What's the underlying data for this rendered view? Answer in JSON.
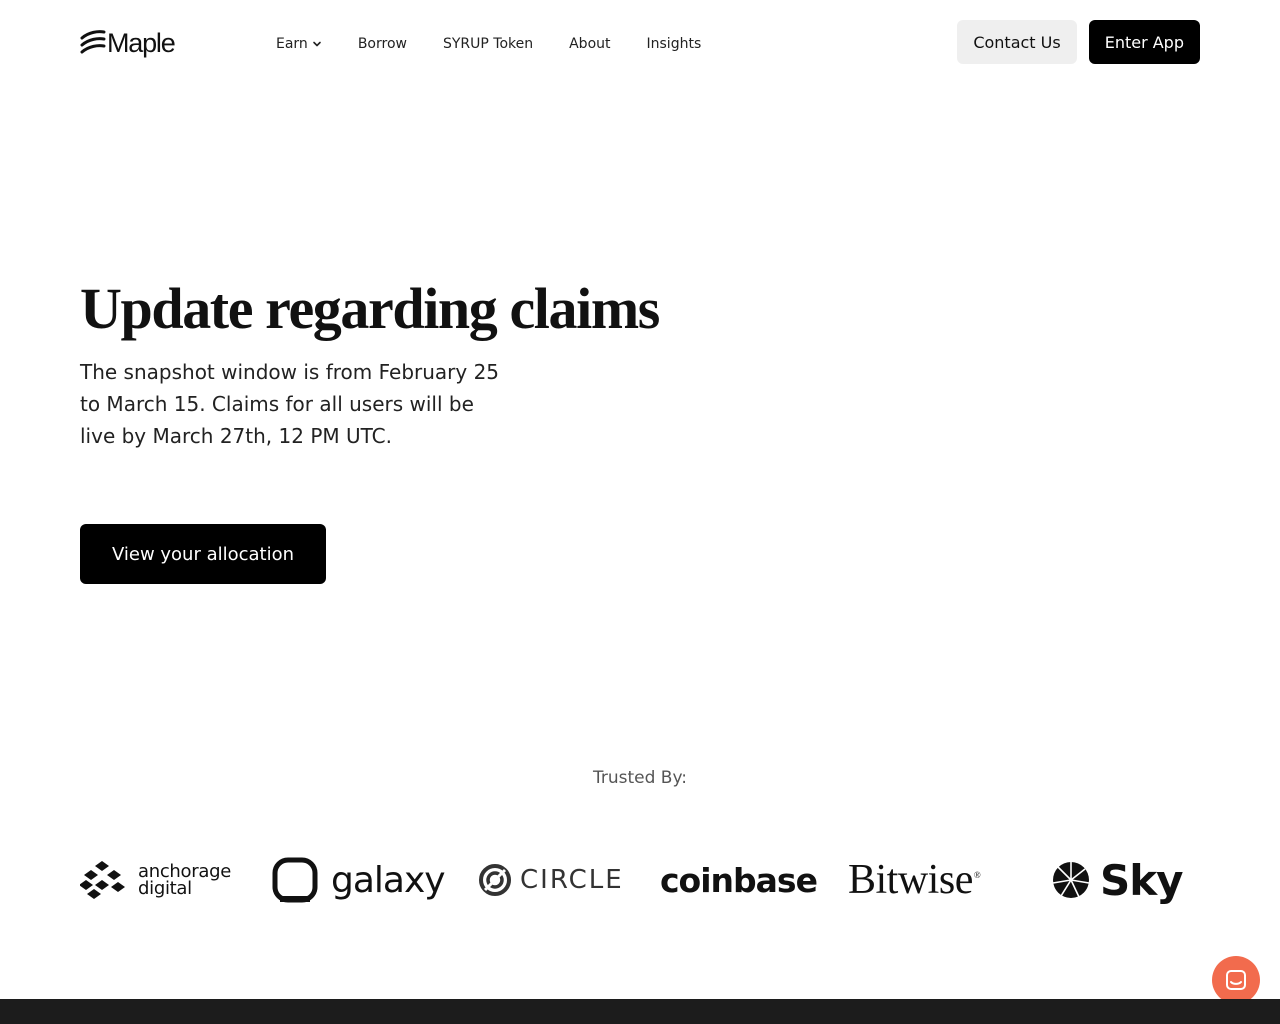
{
  "brand": {
    "name": "Maple",
    "icon": "maple-logo-icon"
  },
  "nav": {
    "links": [
      {
        "label": "Earn",
        "has_dropdown": true
      },
      {
        "label": "Borrow"
      },
      {
        "label": "SYRUP Token"
      },
      {
        "label": "About"
      },
      {
        "label": "Insights"
      }
    ],
    "contact_label": "Contact Us",
    "enter_label": "Enter App"
  },
  "hero": {
    "title": "Update regarding claims",
    "body": "The snapshot window is from February 25 to March 15. Claims for all users will be live by March 27th, 12 PM UTC.",
    "cta_label": "View your allocation"
  },
  "trusted": {
    "label": "Trusted By:",
    "partners": [
      {
        "name": "anchorage",
        "name2": "digital",
        "icon": "anchorage-logo-icon"
      },
      {
        "name": "galaxy",
        "icon": "galaxy-logo-icon"
      },
      {
        "name": "CIRCLE",
        "icon": "circle-logo-icon"
      },
      {
        "name": "coinbase"
      },
      {
        "name": "Bitwise",
        "mark": "®"
      },
      {
        "name": "Sky",
        "icon": "sky-logo-icon"
      }
    ]
  },
  "chat": {
    "icon": "chat-icon"
  },
  "colors": {
    "accent": "#f26b4d",
    "button_dark": "#000000",
    "button_light": "#efefef",
    "footer": "#1c1c1c"
  }
}
